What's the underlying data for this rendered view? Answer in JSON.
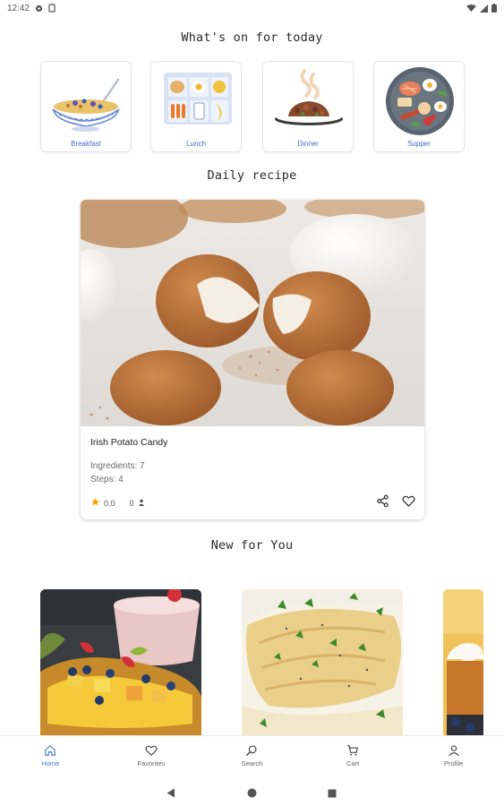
{
  "status_bar": {
    "time": "12:42"
  },
  "sections": {
    "today_title": "What's on for today",
    "daily_title": "Daily recipe",
    "new_title": "New for You"
  },
  "categories": [
    {
      "label": "Breakfast"
    },
    {
      "label": "Lunch"
    },
    {
      "label": "Dinner"
    },
    {
      "label": "Supper"
    }
  ],
  "daily_recipe": {
    "name": "Irish Potato Candy",
    "ingredients": "Ingredients: 7",
    "steps": "Steps: 4",
    "rating": "0.0",
    "reviews": "0"
  },
  "bottom_nav": [
    {
      "label": "Home",
      "icon": "home-icon",
      "active": true
    },
    {
      "label": "Favorites",
      "icon": "heart-icon"
    },
    {
      "label": "Search",
      "icon": "search-icon"
    },
    {
      "label": "Cart",
      "icon": "cart-icon"
    },
    {
      "label": "Profile",
      "icon": "profile-icon"
    }
  ],
  "colors": {
    "accent": "#4a7bd3",
    "star": "#f4a300"
  }
}
